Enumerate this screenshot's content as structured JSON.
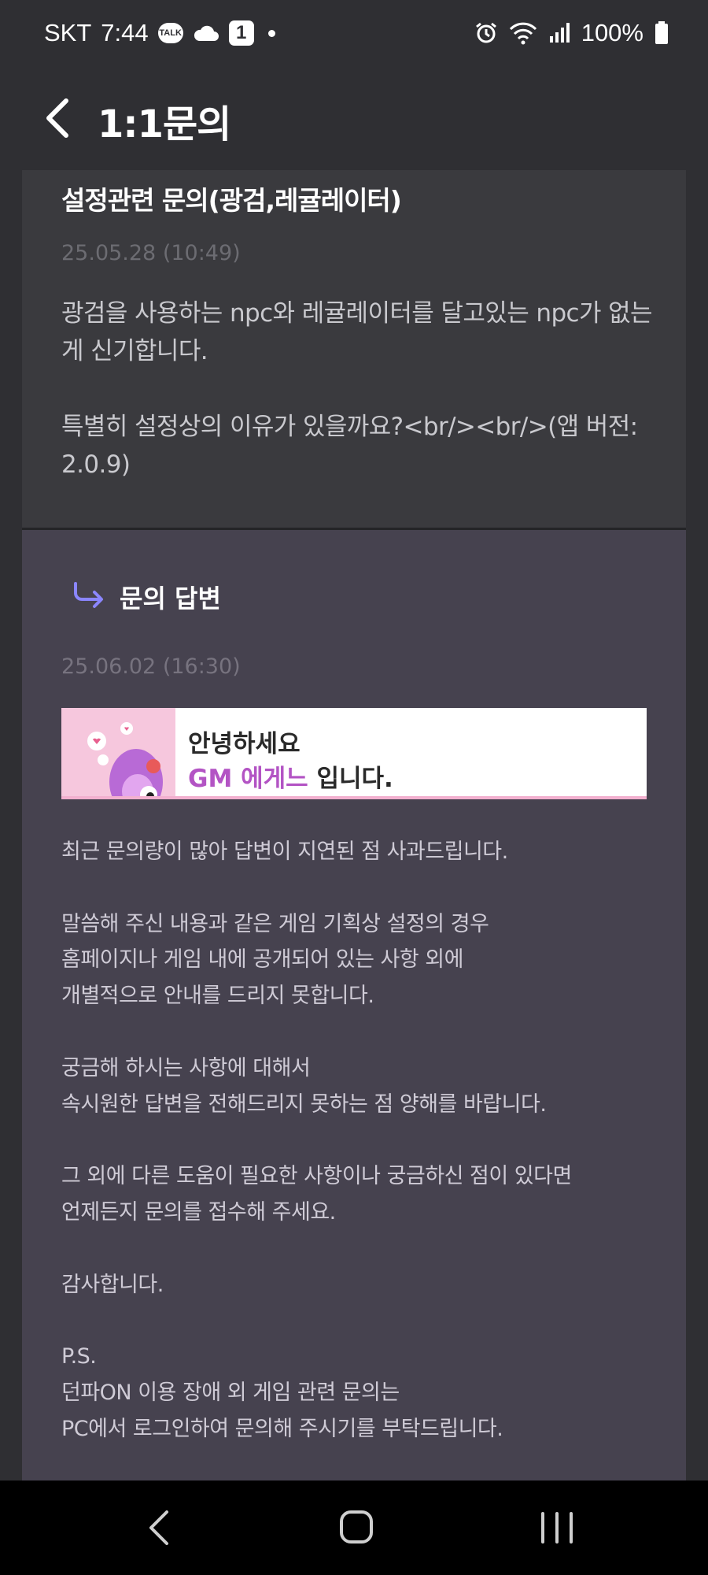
{
  "status_bar": {
    "carrier": "SKT",
    "time": "7:44",
    "talk_badge": "TALK",
    "notification_count": "1",
    "battery": "100%"
  },
  "app_bar": {
    "title": "1:1문의"
  },
  "question": {
    "title": "설정관련 문의(광검,레귤레이터)",
    "date": "25.05.28 (10:49)",
    "body": "광검을 사용하는 npc와 레귤레이터를 달고있는 npc가 없는게 신기합니다.\n\n특별히 설정상의 이유가 있을까요?<br/><br/>(앱 버전: 2.0.9)"
  },
  "answer": {
    "label": "문의 답변",
    "date": "25.06.02 (16:30)",
    "banner": {
      "greeting": "안녕하세요",
      "gm_name": "GM 에게느",
      "suffix": " 입니다."
    },
    "paragraphs": [
      "최근 문의량이 많아 답변이 지연된 점 사과드립니다.",
      "말씀해 주신 내용과 같은 게임 기획상 설정의 경우\n홈페이지나 게임 내에 공개되어 있는 사항 외에\n개별적으로 안내를 드리지 못합니다.",
      "궁금해 하시는 사항에 대해서\n속시원한 답변을 전해드리지 못하는 점 양해를 바랍니다.",
      "그 외에 다른 도움이 필요한 사항이나 궁금하신 점이 있다면\n언제든지 문의를 접수해 주세요.",
      "감사합니다.",
      "P.S.\n던파ON 이용 장애 외 게임 관련 문의는\nPC에서 로그인하여 문의해 주시기를 부탁드립니다."
    ]
  },
  "colors": {
    "background": "#2f2f33",
    "question_card": "#3a3a3e",
    "answer_card": "#46424f",
    "accent_arrow": "#8b86ff",
    "gm_pink": "#b354c4"
  },
  "icons": [
    "talk-icon",
    "cloud-icon",
    "alarm-icon",
    "wifi-icon",
    "signal-icon",
    "battery-icon",
    "back-arrow-icon",
    "reply-arrow-icon",
    "nav-back-icon",
    "nav-home-icon",
    "nav-recents-icon"
  ]
}
